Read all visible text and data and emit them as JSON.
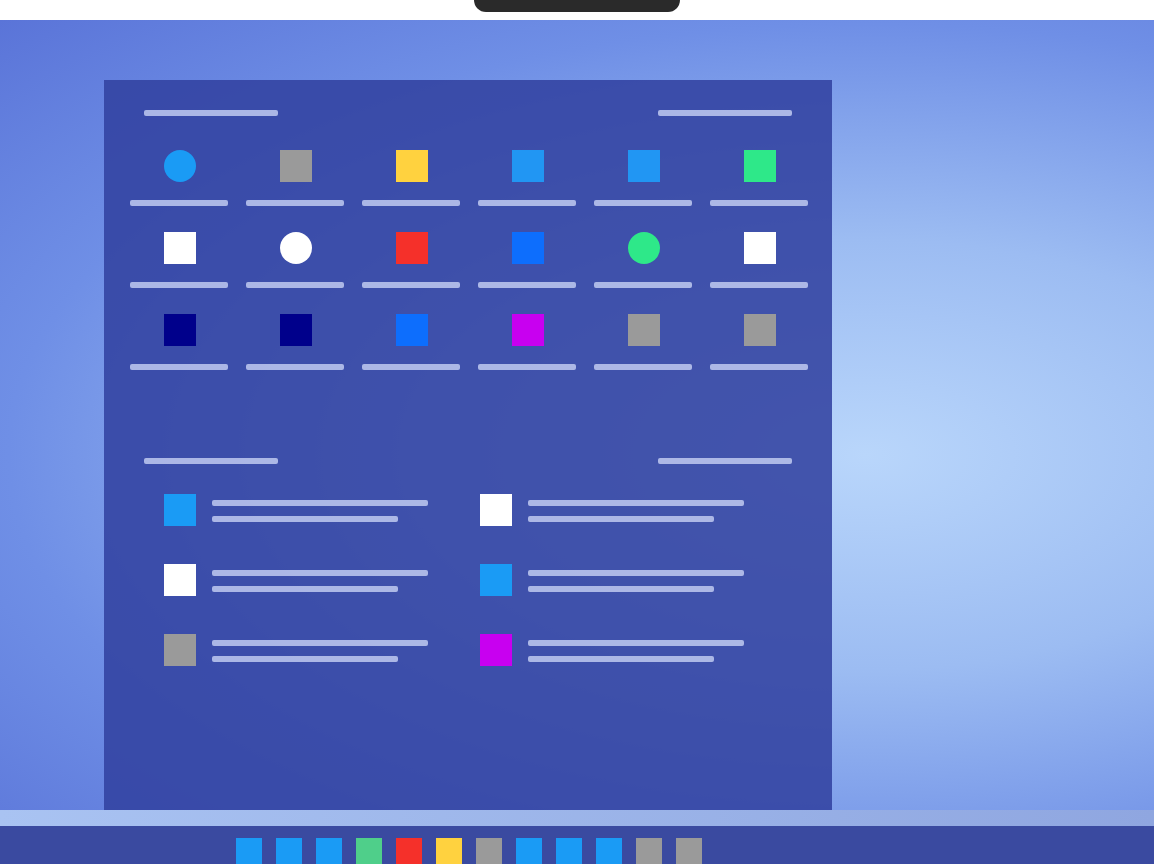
{
  "pinned": [
    {
      "kind": "circle",
      "color": "#1a9bf5"
    },
    {
      "kind": "square",
      "color": "#9a9a9a"
    },
    {
      "kind": "square",
      "color": "#ffd23f"
    },
    {
      "kind": "square",
      "color": "#2196f3"
    },
    {
      "kind": "square",
      "color": "#2196f3"
    },
    {
      "kind": "square",
      "color": "#2ee889"
    },
    {
      "kind": "square",
      "color": "#ffffff"
    },
    {
      "kind": "circle",
      "color": "#ffffff"
    },
    {
      "kind": "square",
      "color": "#f5302a"
    },
    {
      "kind": "square",
      "color": "#0d6efd"
    },
    {
      "kind": "circle",
      "color": "#2ee889"
    },
    {
      "kind": "square",
      "color": "#ffffff"
    },
    {
      "kind": "square",
      "color": "#00008b"
    },
    {
      "kind": "square",
      "color": "#00008b"
    },
    {
      "kind": "square",
      "color": "#0d6efd"
    },
    {
      "kind": "square",
      "color": "#c800f0"
    },
    {
      "kind": "square",
      "color": "#9a9a9a"
    },
    {
      "kind": "square",
      "color": "#9a9a9a"
    }
  ],
  "recommended": [
    {
      "color": "#1a9bf5"
    },
    {
      "color": "#ffffff"
    },
    {
      "color": "#ffffff"
    },
    {
      "color": "#1a9bf5"
    },
    {
      "color": "#9a9a9a"
    },
    {
      "color": "#c800f0"
    }
  ],
  "taskbar": [
    {
      "color": "#1a9bf5"
    },
    {
      "color": "#1a9bf5"
    },
    {
      "color": "#1a9bf5"
    },
    {
      "color": "#4fcf8a"
    },
    {
      "color": "#f5302a"
    },
    {
      "color": "#ffd23f"
    },
    {
      "color": "#9a9a9a"
    },
    {
      "color": "#1a9bf5"
    },
    {
      "color": "#1a9bf5"
    },
    {
      "color": "#1a9bf5"
    },
    {
      "color": "#9a9a9a"
    },
    {
      "color": "#9a9a9a"
    }
  ]
}
